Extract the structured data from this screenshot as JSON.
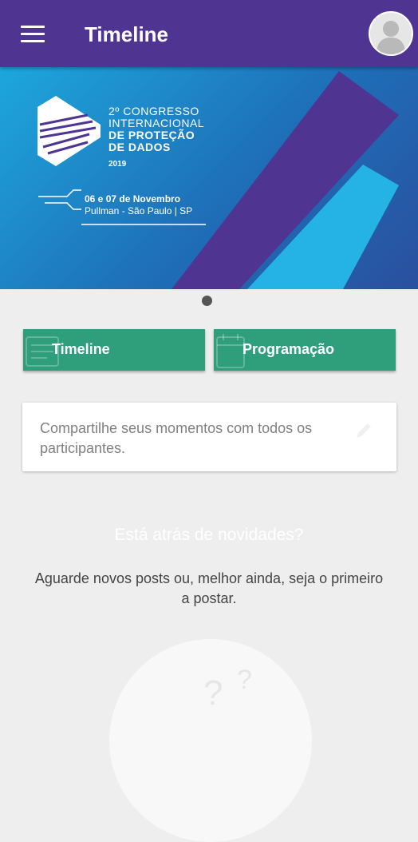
{
  "appbar": {
    "title": "Timeline",
    "menu_icon": "hamburger-menu-icon",
    "avatar_icon": "user-avatar-icon"
  },
  "banner": {
    "logo_line1": "2º CONGRESSO",
    "logo_line2": "INTERNACIONAL",
    "logo_line3": "DE PROTEÇÃO",
    "logo_line4": "DE DADOS",
    "year": "2019",
    "dates": "06 e 07 de Novembro",
    "venue": "Pullman - São Paulo | SP",
    "colors": {
      "primary": "#4f3591",
      "cyan": "#1da7dc",
      "teal": "#2f9e7a"
    }
  },
  "carousel": {
    "page_count": 1,
    "active": 0
  },
  "buttons": {
    "timeline_label": "Timeline",
    "programacao_label": "Programação"
  },
  "share": {
    "placeholder": "Compartilhe seus momentos com todos os participantes."
  },
  "empty": {
    "title": "Está atrás de novidades?",
    "subtitle": "Aguarde novos posts ou, melhor ainda, seja o primeiro a postar."
  }
}
